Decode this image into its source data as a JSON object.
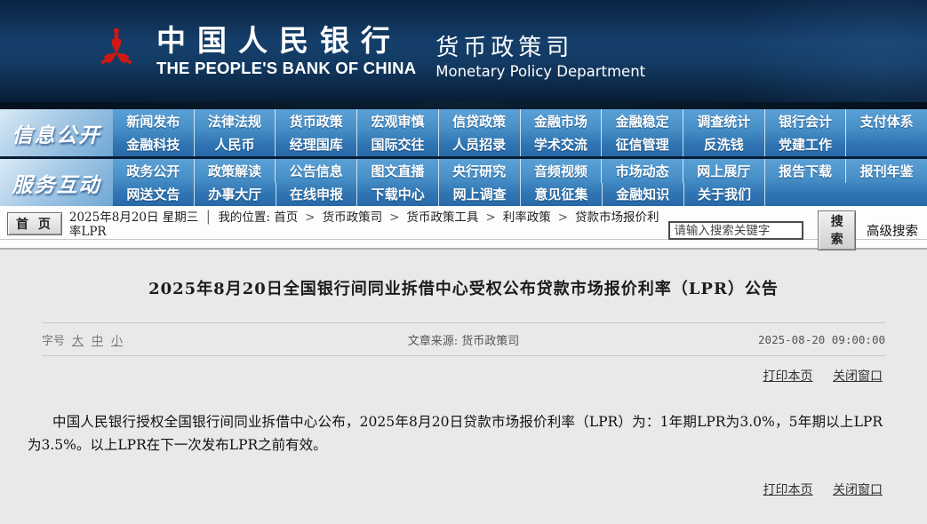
{
  "colors": {
    "header_navy": "#0d2c50",
    "nav_blue": "#3c86c2",
    "nav_label_blue": "#a6c9e5",
    "logo_red": "#d01814",
    "content_bg": "#e9e9e9"
  },
  "header": {
    "bank_name_cn": "中国人民银行",
    "bank_name_en": "THE PEOPLE'S BANK OF CHINA",
    "dept_cn": "货币政策司",
    "dept_en": "Monetary Policy Department"
  },
  "nav": {
    "sections": [
      {
        "label": "信息公开",
        "rows": [
          [
            "新闻发布",
            "法律法规",
            "货币政策",
            "宏观审慎",
            "信贷政策",
            "金融市场",
            "金融稳定",
            "调查统计",
            "银行会计",
            "支付体系"
          ],
          [
            "金融科技",
            "人民币",
            "经理国库",
            "国际交往",
            "人员招录",
            "学术交流",
            "征信管理",
            "反洗钱",
            "党建工作",
            ""
          ]
        ]
      },
      {
        "label": "服务互动",
        "rows": [
          [
            "政务公开",
            "政策解读",
            "公告信息",
            "图文直播",
            "央行研究",
            "音频视频",
            "市场动态",
            "网上展厅",
            "报告下载",
            "报刊年鉴"
          ],
          [
            "网送文告",
            "办事大厅",
            "在线申报",
            "下载中心",
            "网上调查",
            "意见征集",
            "金融知识",
            "关于我们",
            "",
            ""
          ]
        ]
      }
    ]
  },
  "toolbar": {
    "home_button": "首 页",
    "date": "2025年8月20日 星期三",
    "pipe": "│",
    "location_label": "我的位置: 首页",
    "crumbs": [
      "货币政策司",
      "货币政策工具",
      "利率政策",
      "贷款市场报价利率LPR"
    ],
    "search_placeholder": "请输入搜索关键字",
    "search_button": "搜索",
    "advanced_search": "高级搜索"
  },
  "article": {
    "title": "2025年8月20日全国银行间同业拆借中心受权公布贷款市场报价利率（LPR）公告",
    "fontsize_label": "字号",
    "fontsize_options": [
      "大",
      "中",
      "小"
    ],
    "source": "文章来源: 货币政策司",
    "datetime": "2025-08-20 09:00:00",
    "print_link": "打印本页",
    "close_link": "关闭窗口",
    "body": "中国人民银行授权全国银行间同业拆借中心公布，2025年8月20日贷款市场报价利率（LPR）为：1年期LPR为3.0%，5年期以上LPR为3.5%。以上LPR在下一次发布LPR之前有效。"
  }
}
